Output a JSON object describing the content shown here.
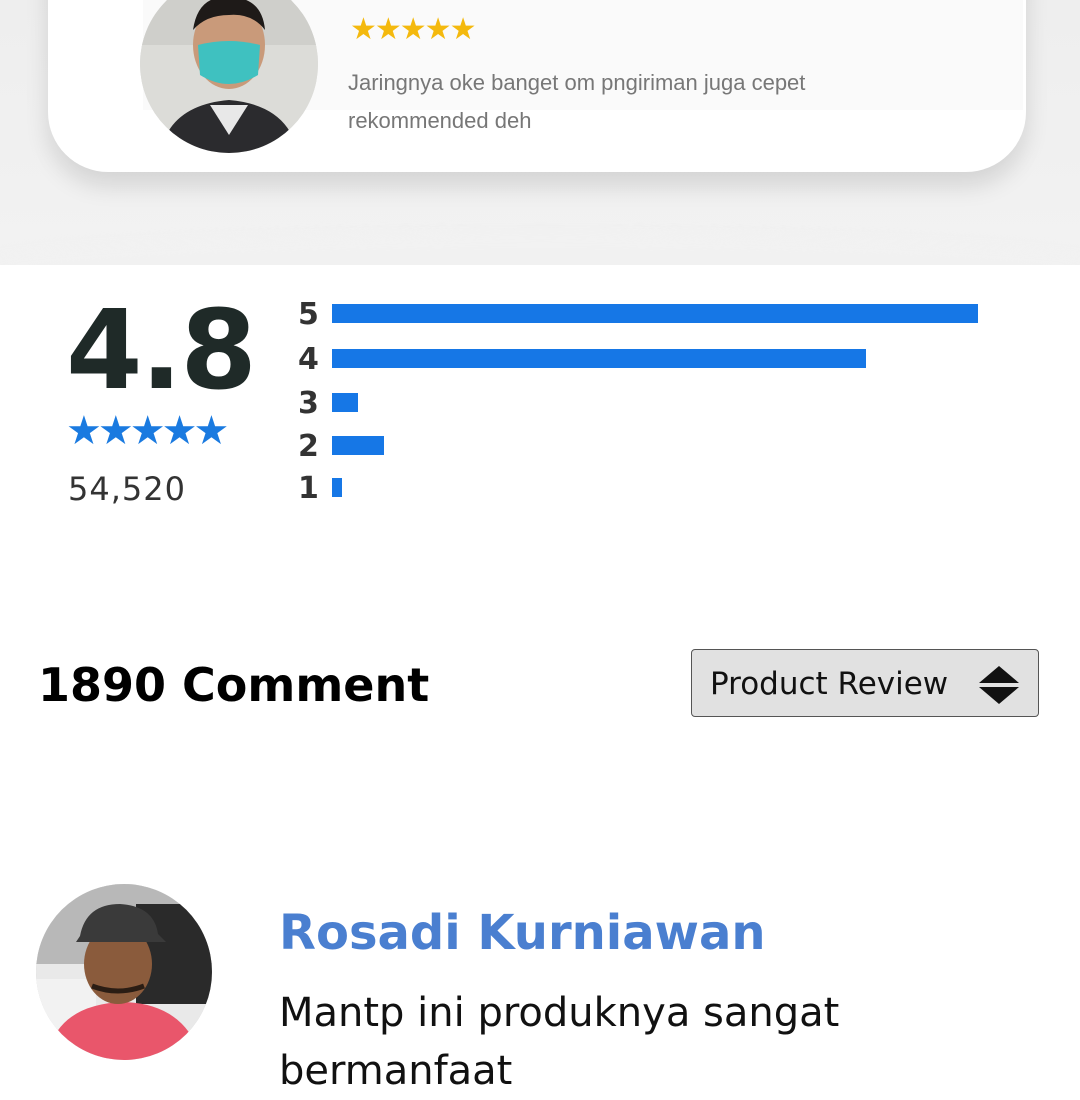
{
  "promo": {
    "review_stars": "★★★★★",
    "review_text": "Jaringnya oke banget om pngiriman juga cepet rekommended deh",
    "rating_value": "4.8",
    "rating_stars": "★★★★★",
    "rating_count": "54,520",
    "rating_bars": [
      {
        "label": "5",
        "fraction": 1.0
      },
      {
        "label": "4",
        "fraction": 0.826
      },
      {
        "label": "3",
        "fraction": 0.04
      },
      {
        "label": "2",
        "fraction": 0.08
      },
      {
        "label": "1",
        "fraction": 0.015
      }
    ]
  },
  "comments": {
    "count_label": "1890 Comment",
    "sort": {
      "selected": "Product Review"
    },
    "items": [
      {
        "author": "Rosadi Kurniawan",
        "text": "Mantp ini produknya sangat bermanfaat"
      }
    ]
  },
  "colors": {
    "accent_blue": "#1677e6",
    "author_blue": "#4a7fd0",
    "star_gold": "#f4b90d"
  }
}
